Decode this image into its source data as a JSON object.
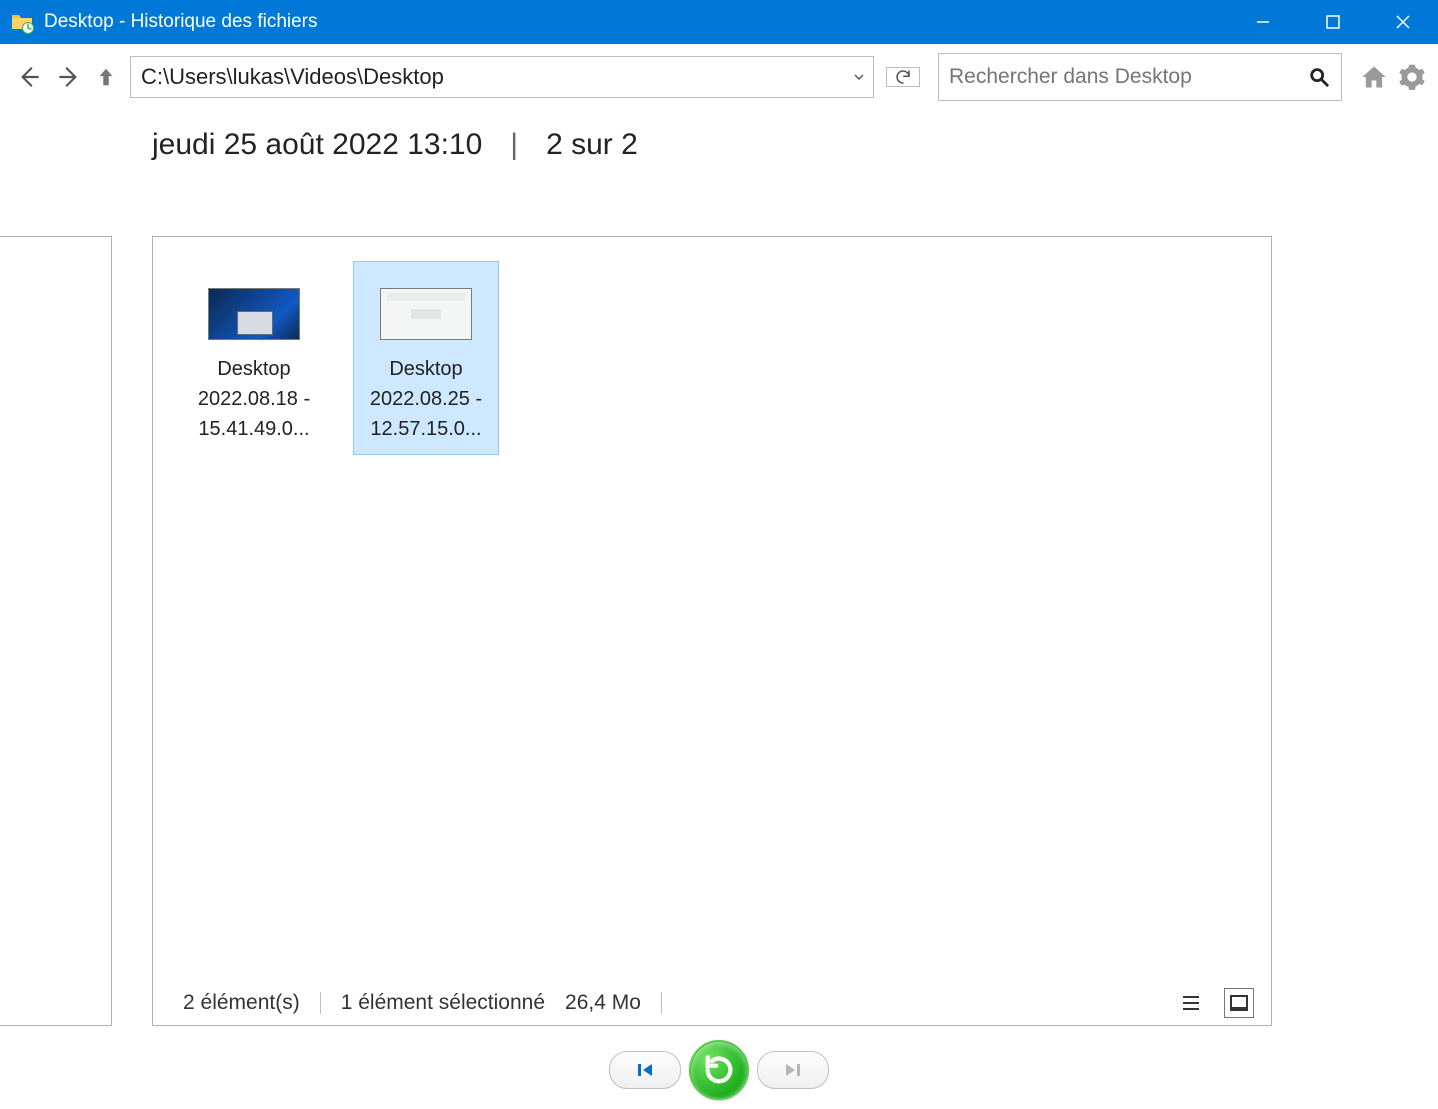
{
  "window": {
    "title": "Desktop - Historique des fichiers"
  },
  "nav": {
    "path": "C:\\Users\\lukas\\Videos\\Desktop",
    "search_placeholder": "Rechercher dans Desktop"
  },
  "header": {
    "timestamp": "jeudi 25 août 2022 13:10",
    "position": "2 sur 2"
  },
  "files": [
    {
      "name": "Desktop 2022.08.18 - 15.41.49.0...",
      "selected": false,
      "thumb": "dark"
    },
    {
      "name": "Desktop 2022.08.25 - 12.57.15.0...",
      "selected": true,
      "thumb": "light"
    }
  ],
  "status": {
    "count": "2 élément(s)",
    "selection": "1 élément sélectionné",
    "size": "26,4 Mo"
  }
}
